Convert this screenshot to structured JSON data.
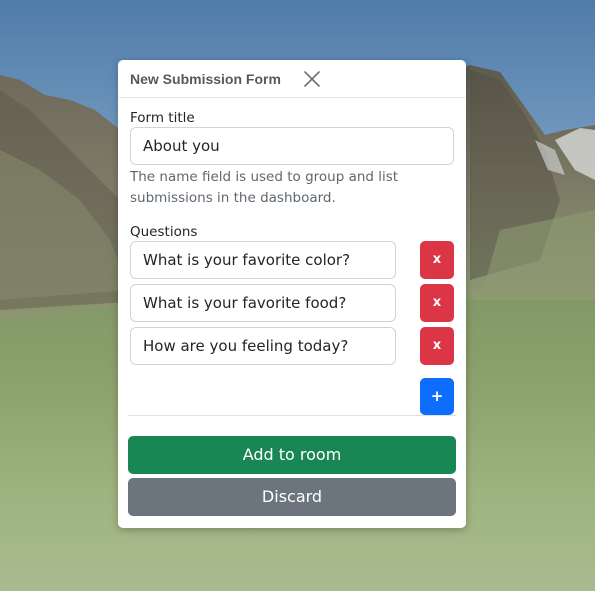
{
  "modal": {
    "title": "New Submission Form",
    "close_icon": "close-icon",
    "form_title_label": "Form title",
    "form_title_value": "About you",
    "help_text": "The name field is used to group and list submissions in the dashboard.",
    "questions_label": "Questions",
    "questions": [
      {
        "value": "What is your favorite color?",
        "delete_label": "x"
      },
      {
        "value": "What is your favorite food?",
        "delete_label": "x"
      },
      {
        "value": "How are you feeling today?",
        "delete_label": "x"
      }
    ],
    "add_question_label": "+",
    "add_to_room_label": "Add to room",
    "discard_label": "Discard"
  },
  "colors": {
    "danger": "#dc3545",
    "primary": "#0d6efd",
    "success": "#198754",
    "secondary": "#6c757d"
  }
}
